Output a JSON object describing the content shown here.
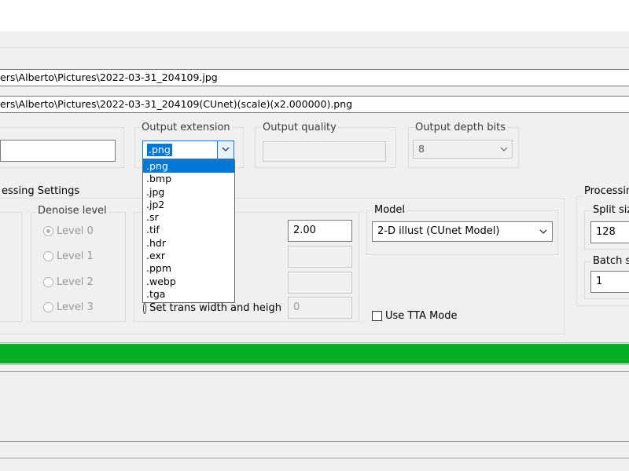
{
  "paths": {
    "input": "ers\\Alberto\\Pictures\\2022-03-31_204109.jpg",
    "output": "ers\\Alberto\\Pictures\\2022-03-31_204109(CUnet)(scale)(x2.000000).png"
  },
  "output_extension": {
    "legend": "Output extension",
    "selected": ".png",
    "options": [
      ".png",
      ".bmp",
      ".jpg",
      ".jp2",
      ".sr",
      ".tif",
      ".hdr",
      ".exr",
      ".ppm",
      ".webp",
      ".tga"
    ]
  },
  "output_quality": {
    "legend": "Output quality"
  },
  "output_depth": {
    "legend": "Output depth bits",
    "selected": "8"
  },
  "conversion": {
    "legend": "essing Settings",
    "denoise_legend": "Denoise level",
    "levels": [
      "Level 0",
      "Level 1",
      "Level 2",
      "Level 3"
    ]
  },
  "scale": {
    "ratio_value": "2.00",
    "trans_label": "Set trans width and heigh",
    "trans_value": "0"
  },
  "model": {
    "legend": "Model",
    "selected": "2-D illust (CUnet Model)"
  },
  "tta": {
    "label": "Use TTA Mode"
  },
  "processing": {
    "legend": "Processin",
    "split_legend": "Split siz",
    "split_value": "128",
    "batch_legend": "Batch si",
    "batch_value": "1"
  },
  "progress": {
    "percent": 100,
    "color": "#06b025"
  }
}
